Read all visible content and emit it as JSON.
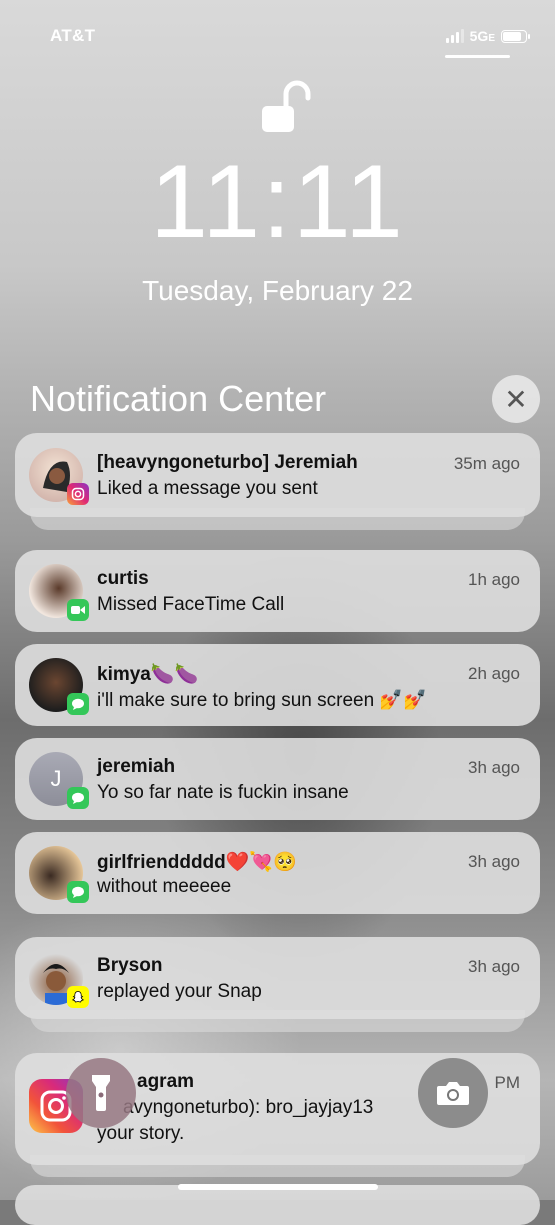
{
  "status": {
    "carrier": "AT&T",
    "network": "5G",
    "network_suffix": "E",
    "signal_bars": 3,
    "battery_level": 0.85
  },
  "lock": {
    "time": "11:11",
    "date": "Tuesday, February 22"
  },
  "notification_center": {
    "title": "Notification Center"
  },
  "notifications": [
    {
      "app": "instagram",
      "title": "[heavyngoneturbo] Jeremiah",
      "body": "Liked a message you sent",
      "time": "35m ago"
    },
    {
      "app": "facetime",
      "title": "curtis",
      "body": "Missed FaceTime Call",
      "time": "1h ago"
    },
    {
      "app": "messages",
      "title": "kimya🍆🍆",
      "body": "i'll make sure to bring sun screen 💅💅",
      "time": "2h ago"
    },
    {
      "app": "messages",
      "title": "jeremiah",
      "body": "Yo so far nate is fuckin insane",
      "time": "3h ago",
      "avatar_initial": "J"
    },
    {
      "app": "messages",
      "title": "girlfrienddddd❤️💘🥺",
      "body": "without meeeee",
      "time": "3h ago"
    },
    {
      "app": "snapchat",
      "title": "Bryson",
      "body": "replayed your Snap",
      "time": "3h ago"
    },
    {
      "app": "instagram",
      "title": "agram",
      "body": "avyngoneturbo): bro_jayjay13",
      "body2": "your story.",
      "time": "PM"
    }
  ],
  "colors": {
    "facetime": "#35c759",
    "messages": "#34c759",
    "snapchat": "#fffc00"
  }
}
